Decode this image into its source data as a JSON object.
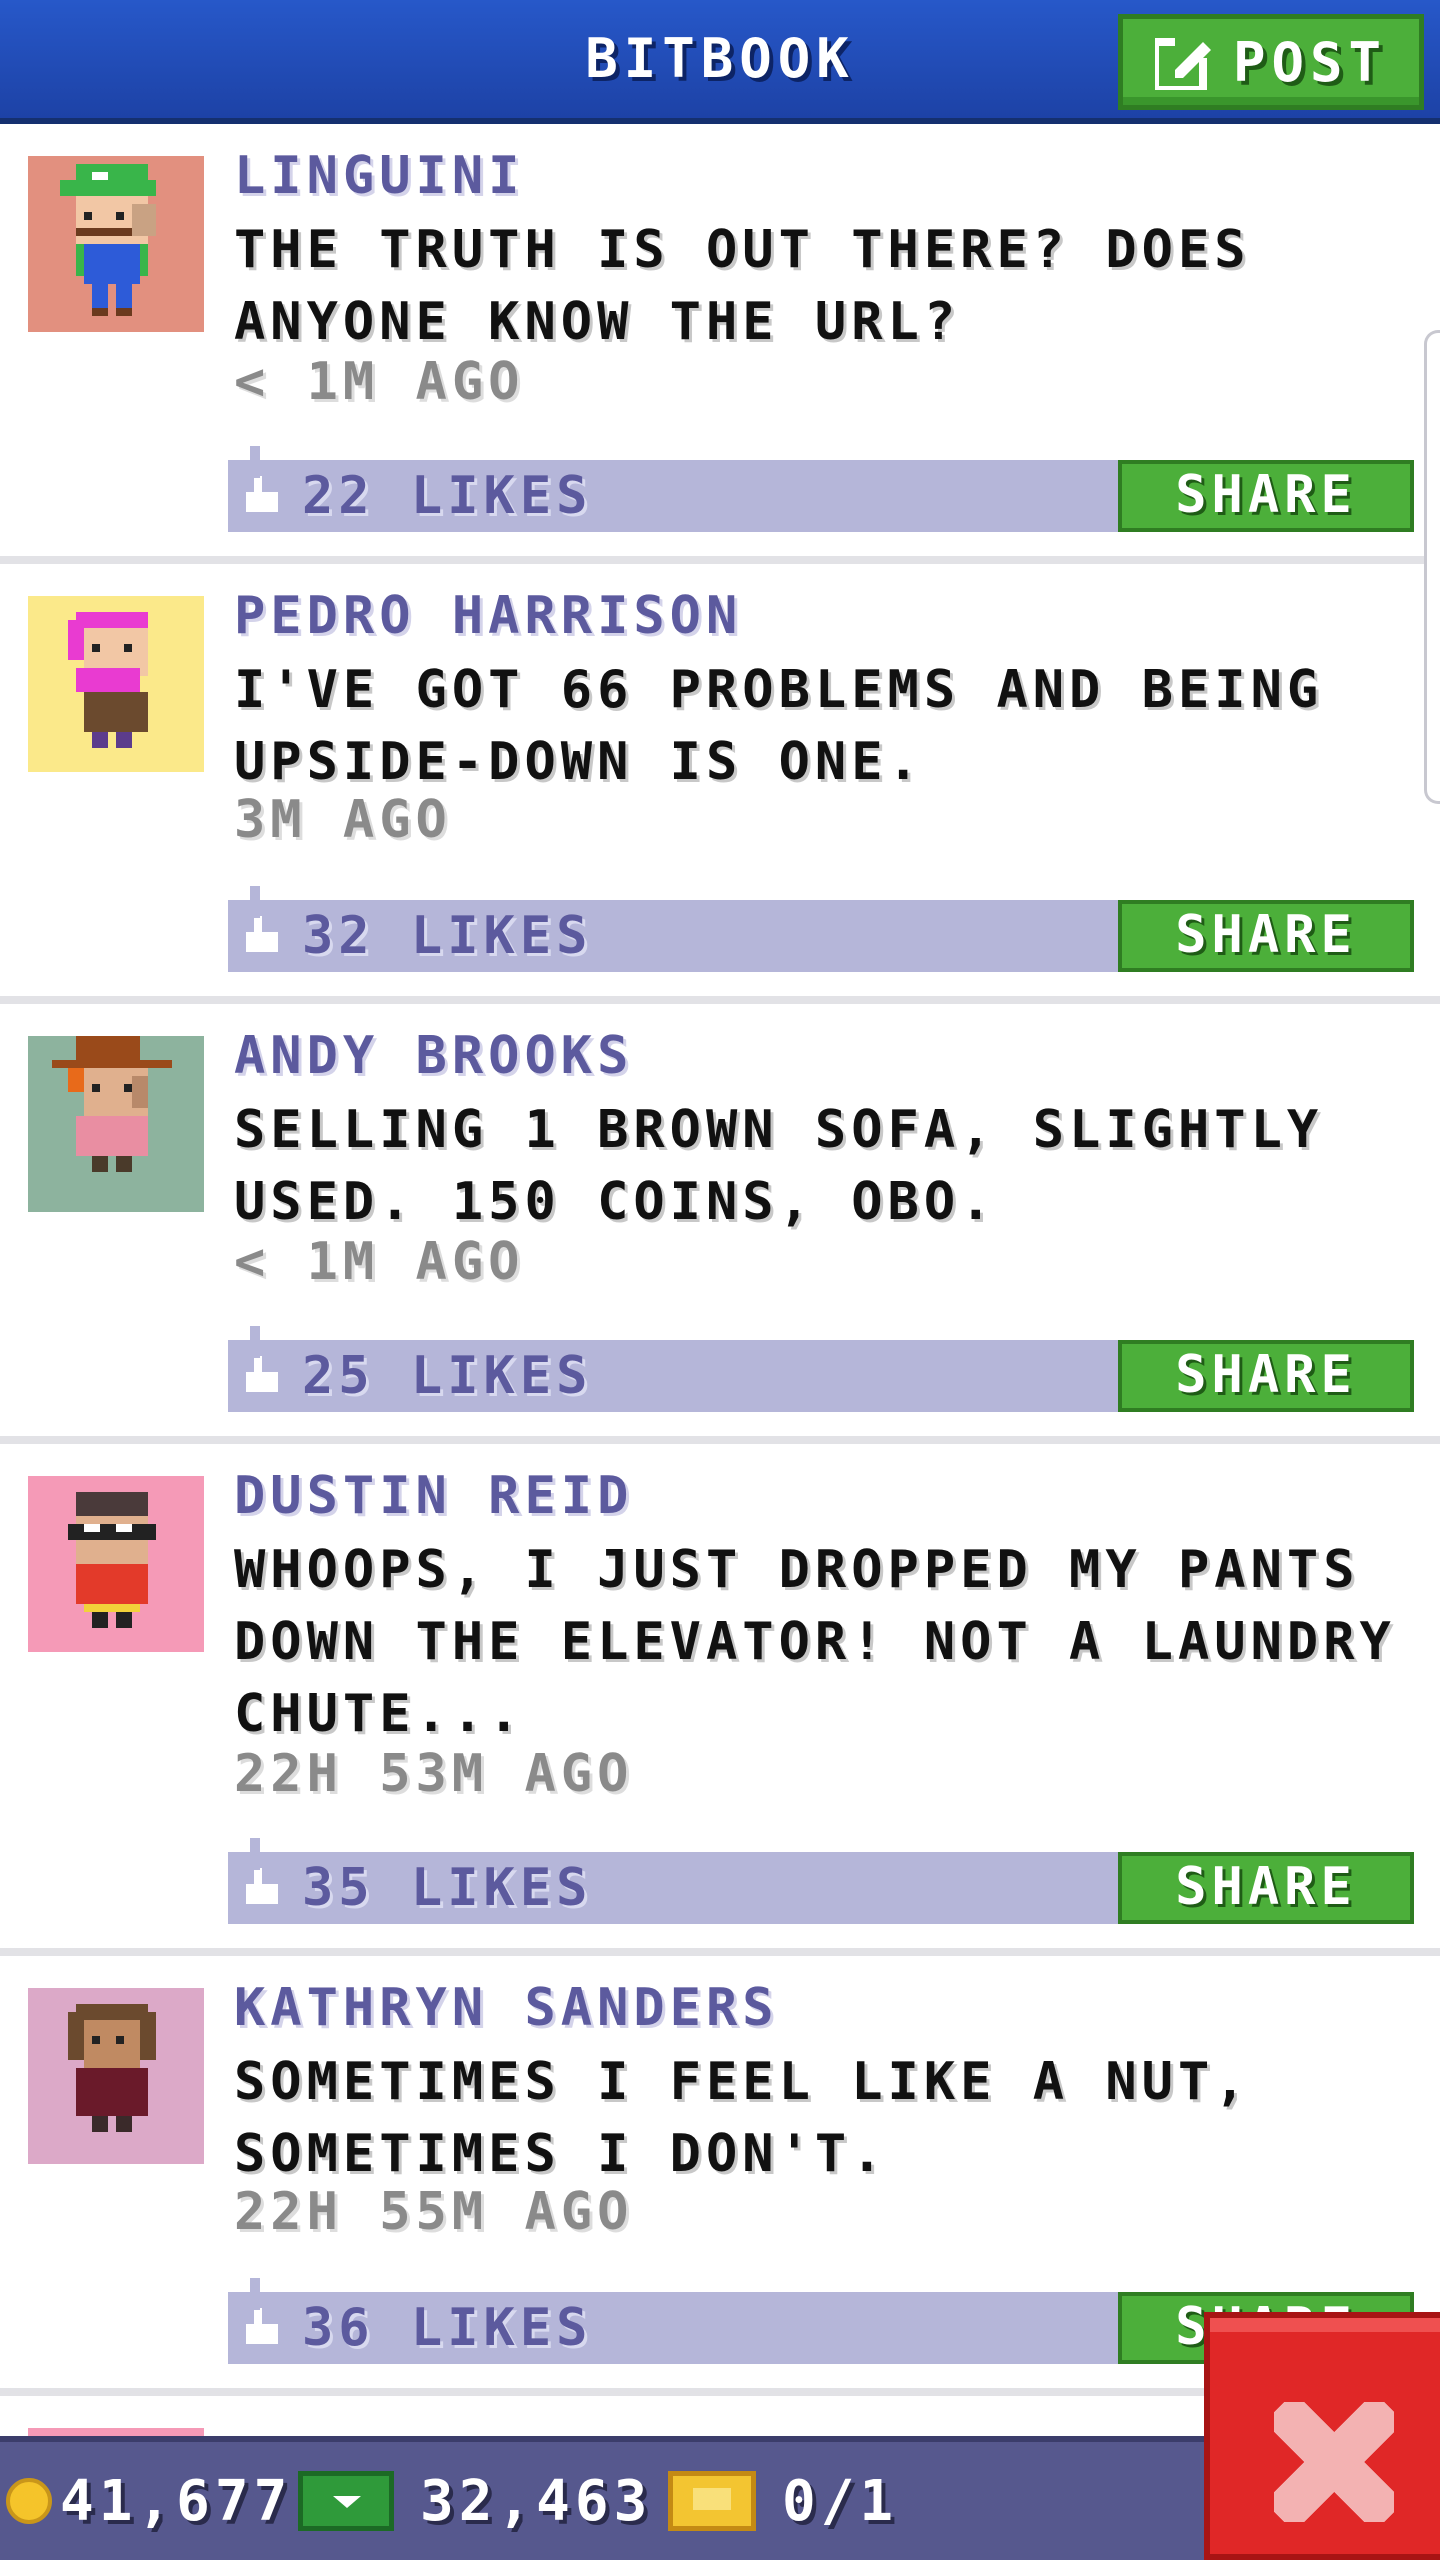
{
  "header": {
    "title": "BITBOOK",
    "post_label": "POST"
  },
  "posts": [
    {
      "author": "LINGUINI",
      "message": "THE TRUTH IS OUT THERE? DOES ANYONE KNOW THE URL?",
      "time": "< 1M AGO",
      "likes": "22 LIKES",
      "share_label": "SHARE",
      "avatar_bg": "#e2907f",
      "avatar_icon": "green-cap-character-avatar"
    },
    {
      "author": "PEDRO HARRISON",
      "message": "I'VE GOT 66 PROBLEMS AND BEING UPSIDE-DOWN IS ONE.",
      "time": "3M AGO",
      "likes": "32 LIKES",
      "share_label": "SHARE",
      "avatar_bg": "#fbe98a",
      "avatar_icon": "pink-hair-character-avatar"
    },
    {
      "author": "ANDY BROOKS",
      "message": "SELLING 1 BROWN SOFA, SLIGHTLY USED. 150 COINS, OBO.",
      "time": "< 1M AGO",
      "likes": "25 LIKES",
      "share_label": "SHARE",
      "avatar_bg": "#8db39e",
      "avatar_icon": "top-hat-character-avatar"
    },
    {
      "author": "DUSTIN REID",
      "message": "WHOOPS, I JUST DROPPED MY PANTS DOWN THE ELEVATOR! NOT A LAUNDRY CHUTE...",
      "time": "22H 53M AGO",
      "likes": "35 LIKES",
      "share_label": "SHARE",
      "avatar_bg": "#f59ab7",
      "avatar_icon": "masked-character-avatar"
    },
    {
      "author": "KATHRYN SANDERS",
      "message": "SOMETIMES I FEEL LIKE A NUT, SOMETIMES I DON'T.",
      "time": "22H 55M AGO",
      "likes": "36 LIKES",
      "share_label": "SHARE",
      "avatar_bg": "#dca9c8",
      "avatar_icon": "brown-hair-character-avatar"
    }
  ],
  "status": {
    "coins": "41,677",
    "bux": "32,463",
    "tickets": "0/1"
  },
  "colors": {
    "header_blue": "#1d42a6",
    "share_green": "#4caf3a",
    "like_bar": "#b5b6d9",
    "author_text": "#5c5a9e",
    "close_red": "#e02727"
  }
}
